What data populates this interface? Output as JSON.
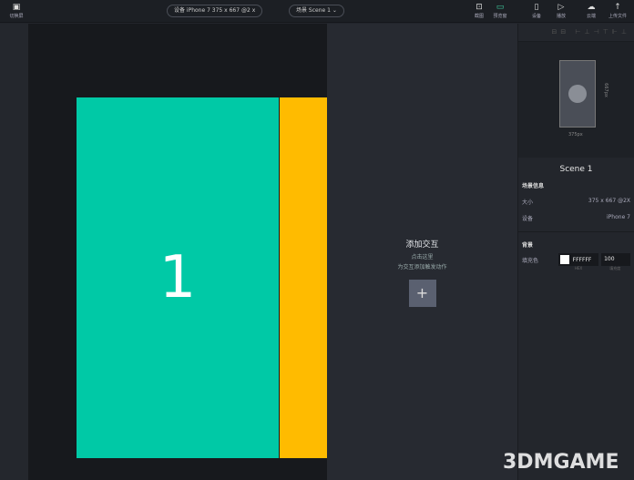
{
  "toolbar": {
    "left_label": "切换屏",
    "device_pill": "设备  iPhone 7  375 x 667  @2 x",
    "scene_pill": "场景  Scene 1  ⌄",
    "buttons": [
      {
        "label": "截图",
        "icon": "screenshot-icon"
      },
      {
        "label": "预览窗",
        "icon": "preview-icon"
      },
      {
        "label": "设备",
        "icon": "device-icon"
      },
      {
        "label": "播放",
        "icon": "play-icon"
      },
      {
        "label": "云端",
        "icon": "cloud-icon"
      },
      {
        "label": "上传文件",
        "icon": "upload-icon"
      }
    ]
  },
  "canvas": {
    "page_number": "1"
  },
  "interaction": {
    "title": "添加交互",
    "line1": "点击这里",
    "line2": "为交互添加触发动作",
    "add": "+"
  },
  "panel": {
    "width_label": "375px",
    "height_label": "667px",
    "scene_title": "Scene 1",
    "info_heading": "场景信息",
    "size_label": "大小",
    "size_value": "375 x 667 @2X",
    "device_label": "设备",
    "device_value": "iPhone 7",
    "bg_heading": "背景",
    "fill_label": "填充色",
    "hex_value": "FFFFFF",
    "opacity_value": "100",
    "hex_caption": "HEX",
    "opacity_caption": "填充度"
  },
  "watermark": "3DMGAME"
}
